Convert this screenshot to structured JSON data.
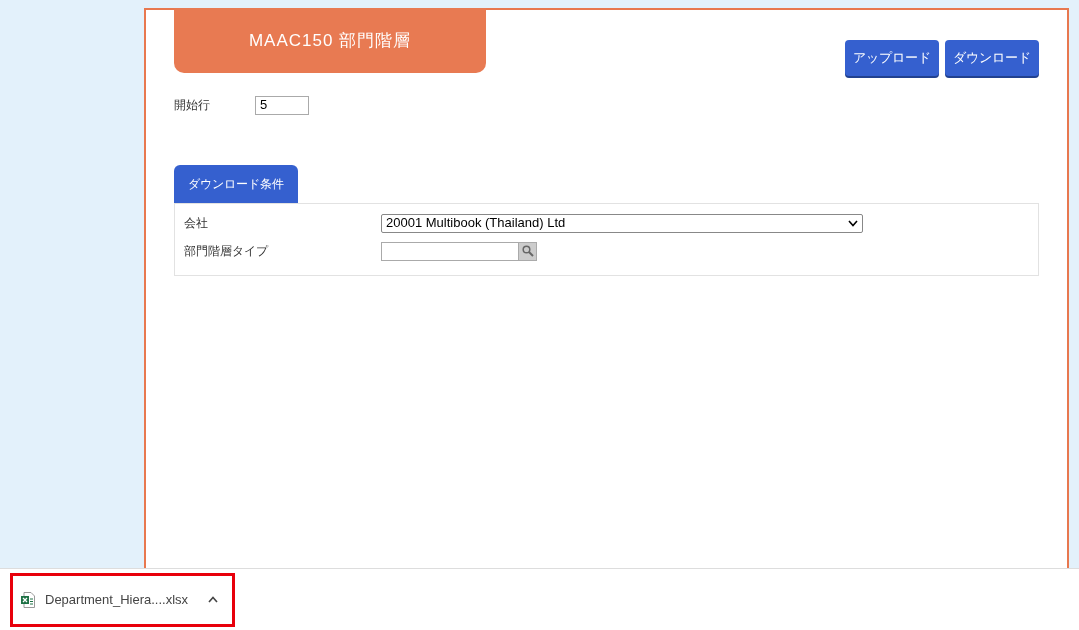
{
  "header": {
    "title": "MAAC150 部門階層"
  },
  "buttons": [
    "アップロード",
    "ダウンロード"
  ],
  "start_row": {
    "label": "開始行",
    "value": "5"
  },
  "tabs": [
    {
      "label": "ダウンロード条件",
      "selected": true
    }
  ],
  "fields": [
    {
      "kind": "select",
      "label": "会社",
      "value": "20001 Multibook (Thailand) Ltd"
    },
    {
      "kind": "lookup",
      "label": "部門階層タイプ"
    }
  ],
  "download_bar": {
    "file_name": "Department_Hiera....xlsx",
    "highlighted": true
  }
}
